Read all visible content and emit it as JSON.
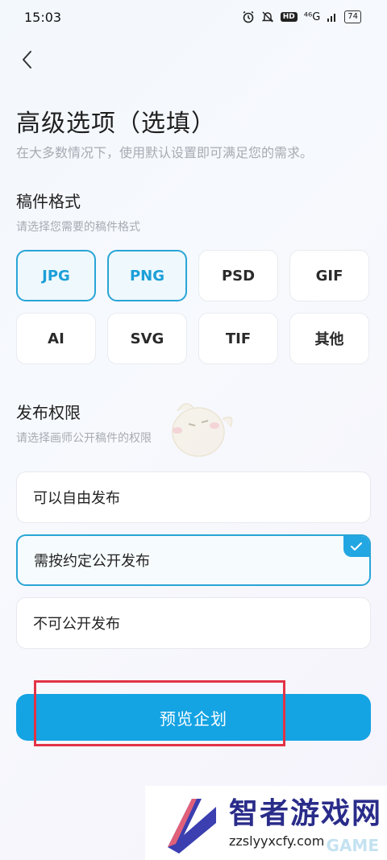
{
  "status_bar": {
    "time": "15:03",
    "hd_badge": "HD",
    "network": "⁴⁶G",
    "battery": "74"
  },
  "header": {
    "title": "高级选项（选填）",
    "subtitle": "在大多数情况下，使用默认设置即可满足您的需求。"
  },
  "format_section": {
    "title": "稿件格式",
    "hint": "请选择您需要的稿件格式",
    "options": [
      {
        "label": "JPG",
        "selected": true
      },
      {
        "label": "PNG",
        "selected": true
      },
      {
        "label": "PSD",
        "selected": false
      },
      {
        "label": "GIF",
        "selected": false
      },
      {
        "label": "AI",
        "selected": false
      },
      {
        "label": "SVG",
        "selected": false
      },
      {
        "label": "TIF",
        "selected": false
      },
      {
        "label": "其他",
        "selected": false
      }
    ]
  },
  "permission_section": {
    "title": "发布权限",
    "hint": "请选择画师公开稿件的权限",
    "options": [
      {
        "label": "可以自由发布",
        "selected": false
      },
      {
        "label": "需按约定公开发布",
        "selected": true
      },
      {
        "label": "不可公开发布",
        "selected": false
      }
    ]
  },
  "actions": {
    "preview_label": "预览企划"
  },
  "watermark": {
    "name": "智者游戏网",
    "url": "zzslyyxcfy.com",
    "game": "GAME"
  },
  "colors": {
    "accent": "#14a3e3",
    "selected_border": "#29a5d6",
    "highlight": "#e23346"
  }
}
